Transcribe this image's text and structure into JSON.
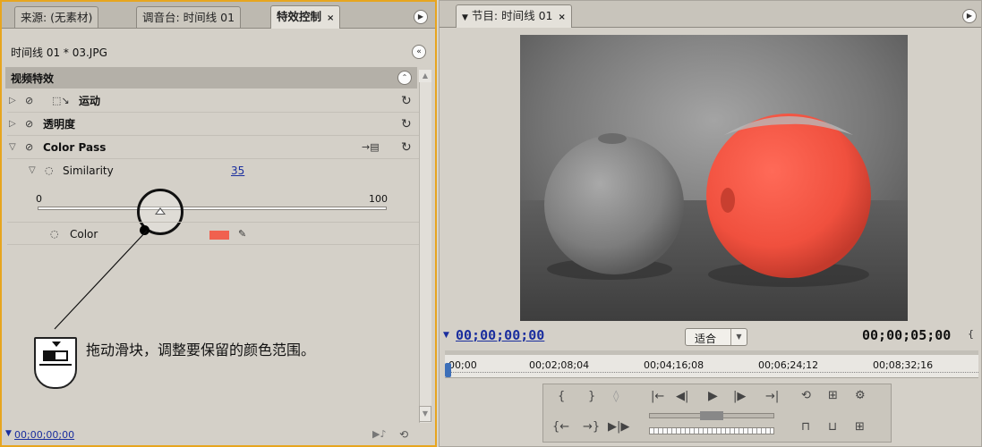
{
  "left_panel": {
    "tabs": [
      {
        "label": "来源: (无素材)"
      },
      {
        "label": "调音台: 时间线 01"
      },
      {
        "label": "特效控制",
        "close": "×"
      }
    ],
    "clip_title": "时间线 01 * 03.JPG",
    "section_header": "视频特效",
    "effects": [
      {
        "label": "运动"
      },
      {
        "label": "透明度"
      },
      {
        "label": "Color Pass"
      }
    ],
    "param_similarity": {
      "label": "Similarity",
      "value": "35",
      "min": "0",
      "max": "100",
      "slider_value": 35
    },
    "param_color": {
      "label": "Color",
      "swatch": "#f0614f"
    },
    "timecode": "00;00;00;00",
    "annotation": "拖动滑块，调整要保留的颜色范围。"
  },
  "right_panel": {
    "tab": {
      "label": "节目: 时间线 01",
      "close": "×"
    },
    "timecode_current": "00;00;00;00",
    "fit_label": "适合",
    "timecode_duration": "00;00;05;00",
    "ruler_ticks": [
      "00;00",
      "00;02;08;04",
      "00;04;16;08",
      "00;06;24;12",
      "00;08;32;16"
    ]
  },
  "colors": {
    "accent_border": "#e7a51f",
    "link": "#1a2e9e",
    "tomato": "#f0614f"
  }
}
